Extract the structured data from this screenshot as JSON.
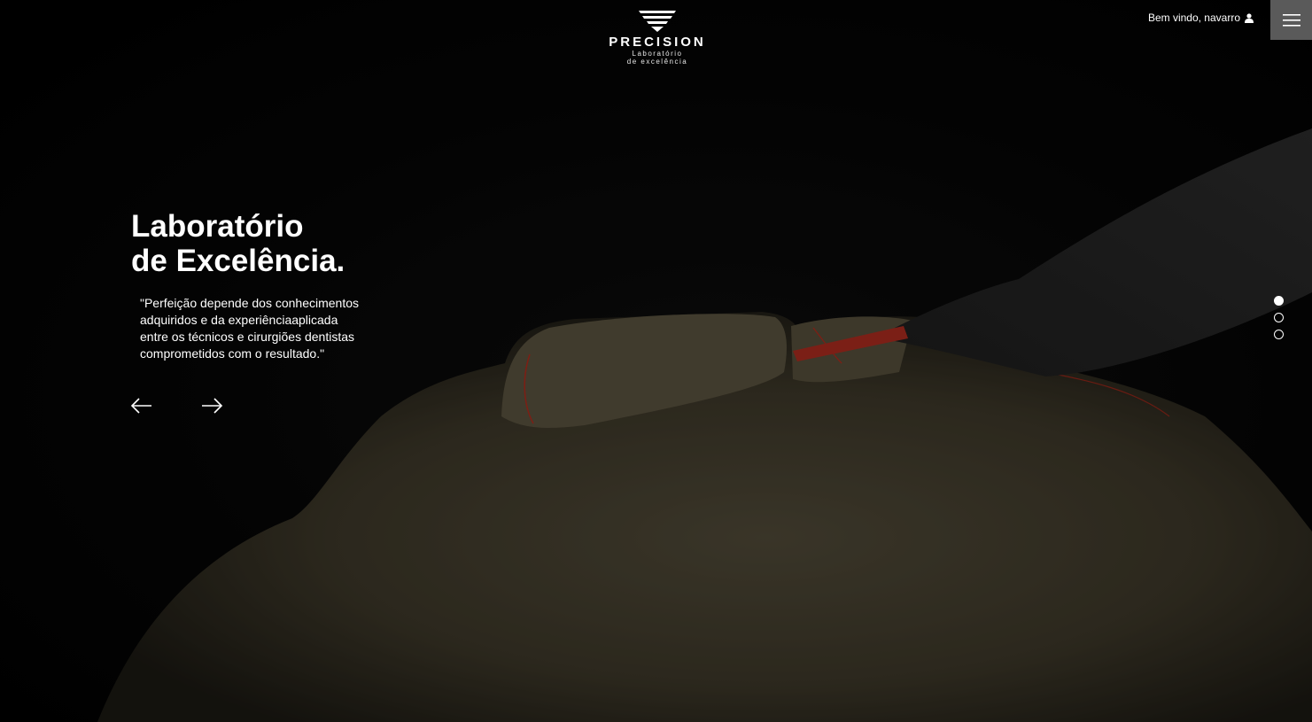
{
  "brand": {
    "name": "PRECISION",
    "tagline_line1": "Laboratório",
    "tagline_line2": "de excelência"
  },
  "header": {
    "welcome_text": "Bem vindo, navarro",
    "user_icon": "user-icon",
    "menu_icon": "hamburger-menu-icon"
  },
  "hero": {
    "headline_line1": "Laboratório",
    "headline_line2": "de Excelência.",
    "quote_lines": [
      "\"Perfeição depende dos conhecimentos",
      "adquiridos e da experiênciaaplicada",
      "entre os técnicos e cirurgiões dentistas",
      "comprometidos com o resultado.\""
    ],
    "prev_icon": "arrow-left-icon",
    "next_icon": "arrow-right-icon"
  },
  "carousel": {
    "slides": 3,
    "active_index": 0
  },
  "colors": {
    "background": "#000000",
    "text": "#ffffff",
    "menu_button": "#5a5a5a",
    "stone_model": "#4a4433",
    "accent_red": "#b3241a"
  }
}
